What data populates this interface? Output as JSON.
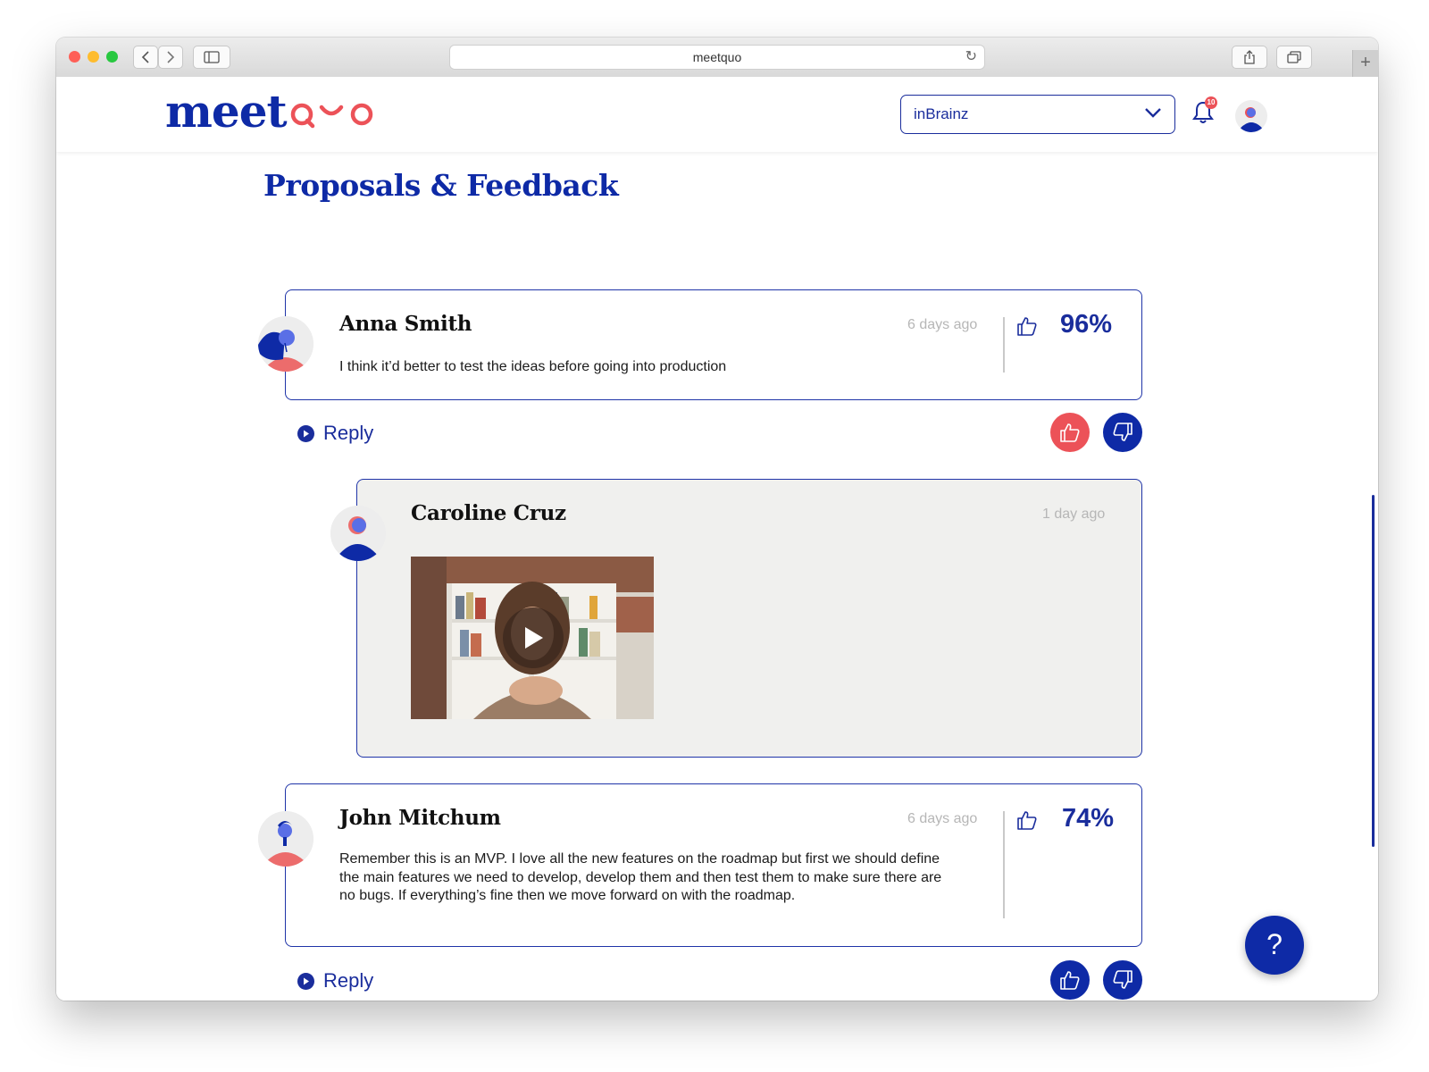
{
  "browser": {
    "url": "meetquo"
  },
  "app": {
    "logo_part1": "meet",
    "logo_part2": "quo",
    "org_selected": "inBrainz",
    "notification_count": "10",
    "page_title": "Proposals & Feedback",
    "help_label": "?"
  },
  "colors": {
    "brand_blue": "#0e2aa6",
    "accent_coral": "#ec5258",
    "card_border": "#1f34a8"
  },
  "feed": {
    "reply_label": "Reply",
    "comments": [
      {
        "author": "Anna Smith",
        "time": "6 days ago",
        "text": "I think it’d better to test the ideas before going into production",
        "approval": "96%",
        "liked": true
      },
      {
        "author": "Caroline Cruz",
        "time": "1 day ago",
        "attachment": "video",
        "is_reply": true
      },
      {
        "author": "John Mitchum",
        "time": "6 days ago",
        "text": "Remember this is an MVP. I love all the new features on the roadmap but first we should define the main features we need to develop, develop them and then test them to make sure there are no bugs. If everything’s fine then we move forward on with the roadmap.",
        "approval": "74%",
        "liked": false
      }
    ]
  }
}
